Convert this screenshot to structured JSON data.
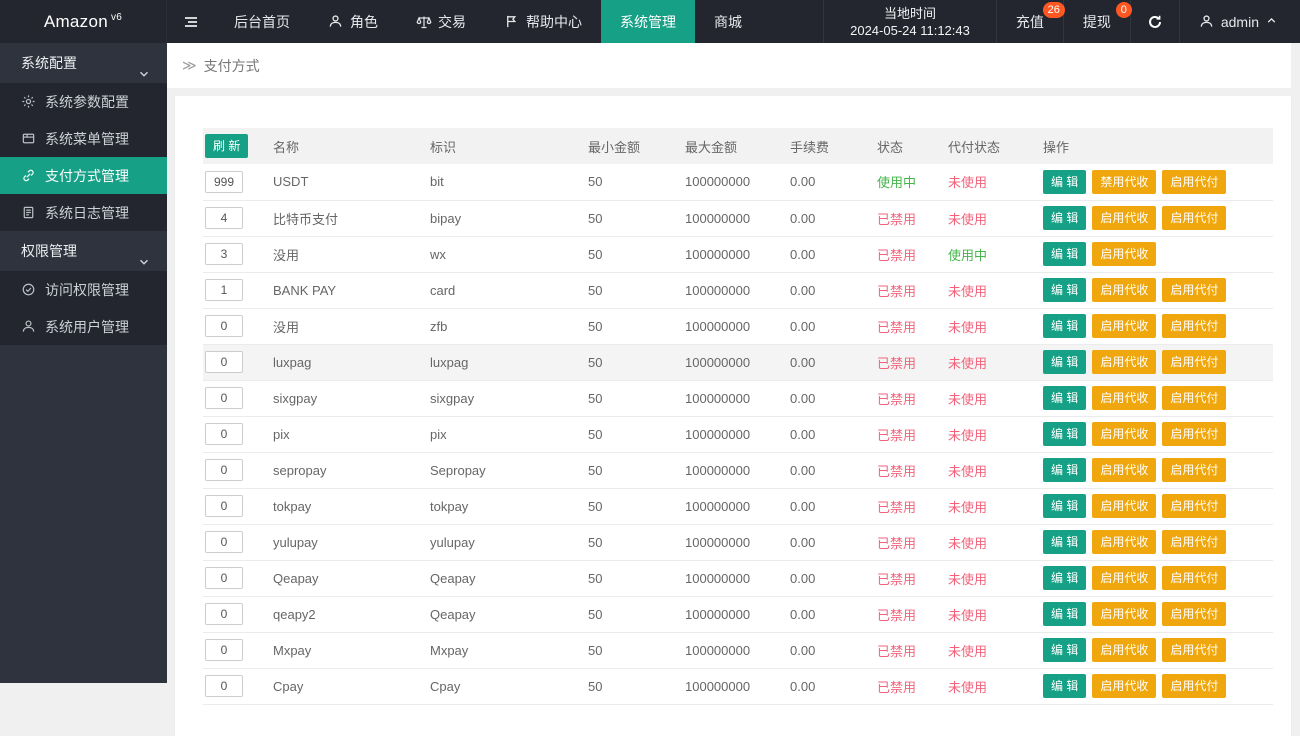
{
  "navbar": {
    "brand": "Amazon",
    "brand_sup": "v6",
    "menu": [
      {
        "label": "后台首页",
        "icon": null
      },
      {
        "label": "角色",
        "icon": "person-icon"
      },
      {
        "label": "交易",
        "icon": "scales-icon"
      },
      {
        "label": "帮助中心",
        "icon": "flag-icon"
      },
      {
        "label": "系统管理",
        "icon": null,
        "active": true
      },
      {
        "label": "商城",
        "icon": null
      }
    ],
    "time_label": "当地时间",
    "time_value": "2024-05-24 11:12:43",
    "recharge": {
      "label": "充值",
      "badge": "26"
    },
    "withdraw": {
      "label": "提现",
      "badge": "0"
    },
    "user": "admin"
  },
  "sidebar": {
    "groups": [
      {
        "label": "系统配置",
        "items": [
          {
            "label": "系统参数配置",
            "icon": "gear-icon"
          },
          {
            "label": "系统菜单管理",
            "icon": "menu-panel-icon"
          },
          {
            "label": "支付方式管理",
            "icon": "link-icon",
            "active": true
          },
          {
            "label": "系统日志管理",
            "icon": "log-file-icon"
          }
        ]
      },
      {
        "label": "权限管理",
        "items": [
          {
            "label": "访问权限管理",
            "icon": "shield-check-icon"
          },
          {
            "label": "系统用户管理",
            "icon": "user-icon"
          }
        ]
      }
    ]
  },
  "breadcrumb": {
    "label": "支付方式"
  },
  "table": {
    "refresh_label": "刷 新",
    "headers": [
      "名称",
      "标识",
      "最小金额",
      "最大金额",
      "手续费",
      "状态",
      "代付状态",
      "操作"
    ],
    "rows": [
      {
        "sort": "999",
        "name": "USDT",
        "code": "bit",
        "min": "50",
        "max": "100000000",
        "fee": "0.00",
        "status": {
          "text": "使用中",
          "on": true
        },
        "payout_status": {
          "text": "未使用",
          "on": false
        },
        "actions": [
          {
            "label": "编 辑",
            "kind": "edit"
          },
          {
            "label": "禁用代收",
            "kind": "collect"
          },
          {
            "label": "启用代付",
            "kind": "payout"
          }
        ]
      },
      {
        "sort": "4",
        "name": "比特币支付",
        "code": "bipay",
        "min": "50",
        "max": "100000000",
        "fee": "0.00",
        "status": {
          "text": "已禁用",
          "on": false
        },
        "payout_status": {
          "text": "未使用",
          "on": false
        },
        "actions": [
          {
            "label": "编 辑",
            "kind": "edit"
          },
          {
            "label": "启用代收",
            "kind": "collect"
          },
          {
            "label": "启用代付",
            "kind": "payout"
          }
        ]
      },
      {
        "sort": "3",
        "name": "没用",
        "code": "wx",
        "min": "50",
        "max": "100000000",
        "fee": "0.00",
        "status": {
          "text": "已禁用",
          "on": false
        },
        "payout_status": {
          "text": "使用中",
          "on": true
        },
        "actions": [
          {
            "label": "编 辑",
            "kind": "edit"
          },
          {
            "label": "启用代收",
            "kind": "collect"
          }
        ]
      },
      {
        "sort": "1",
        "name": "BANK PAY",
        "code": "card",
        "min": "50",
        "max": "100000000",
        "fee": "0.00",
        "status": {
          "text": "已禁用",
          "on": false
        },
        "payout_status": {
          "text": "未使用",
          "on": false
        },
        "actions": [
          {
            "label": "编 辑",
            "kind": "edit"
          },
          {
            "label": "启用代收",
            "kind": "collect"
          },
          {
            "label": "启用代付",
            "kind": "payout"
          }
        ]
      },
      {
        "sort": "0",
        "name": "没用",
        "code": "zfb",
        "min": "50",
        "max": "100000000",
        "fee": "0.00",
        "status": {
          "text": "已禁用",
          "on": false
        },
        "payout_status": {
          "text": "未使用",
          "on": false
        },
        "actions": [
          {
            "label": "编 辑",
            "kind": "edit"
          },
          {
            "label": "启用代收",
            "kind": "collect"
          },
          {
            "label": "启用代付",
            "kind": "payout"
          }
        ]
      },
      {
        "sort": "0",
        "name": "luxpag",
        "code": "luxpag",
        "min": "50",
        "max": "100000000",
        "fee": "0.00",
        "hover": true,
        "status": {
          "text": "已禁用",
          "on": false
        },
        "payout_status": {
          "text": "未使用",
          "on": false
        },
        "actions": [
          {
            "label": "编 辑",
            "kind": "edit"
          },
          {
            "label": "启用代收",
            "kind": "collect"
          },
          {
            "label": "启用代付",
            "kind": "payout"
          }
        ]
      },
      {
        "sort": "0",
        "name": "sixgpay",
        "code": "sixgpay",
        "min": "50",
        "max": "100000000",
        "fee": "0.00",
        "status": {
          "text": "已禁用",
          "on": false
        },
        "payout_status": {
          "text": "未使用",
          "on": false
        },
        "actions": [
          {
            "label": "编 辑",
            "kind": "edit"
          },
          {
            "label": "启用代收",
            "kind": "collect"
          },
          {
            "label": "启用代付",
            "kind": "payout"
          }
        ]
      },
      {
        "sort": "0",
        "name": "pix",
        "code": "pix",
        "min": "50",
        "max": "100000000",
        "fee": "0.00",
        "status": {
          "text": "已禁用",
          "on": false
        },
        "payout_status": {
          "text": "未使用",
          "on": false
        },
        "actions": [
          {
            "label": "编 辑",
            "kind": "edit"
          },
          {
            "label": "启用代收",
            "kind": "collect"
          },
          {
            "label": "启用代付",
            "kind": "payout"
          }
        ]
      },
      {
        "sort": "0",
        "name": "sepropay",
        "code": "Sepropay",
        "min": "50",
        "max": "100000000",
        "fee": "0.00",
        "status": {
          "text": "已禁用",
          "on": false
        },
        "payout_status": {
          "text": "未使用",
          "on": false
        },
        "actions": [
          {
            "label": "编 辑",
            "kind": "edit"
          },
          {
            "label": "启用代收",
            "kind": "collect"
          },
          {
            "label": "启用代付",
            "kind": "payout"
          }
        ]
      },
      {
        "sort": "0",
        "name": "tokpay",
        "code": "tokpay",
        "min": "50",
        "max": "100000000",
        "fee": "0.00",
        "status": {
          "text": "已禁用",
          "on": false
        },
        "payout_status": {
          "text": "未使用",
          "on": false
        },
        "actions": [
          {
            "label": "编 辑",
            "kind": "edit"
          },
          {
            "label": "启用代收",
            "kind": "collect"
          },
          {
            "label": "启用代付",
            "kind": "payout"
          }
        ]
      },
      {
        "sort": "0",
        "name": "yulupay",
        "code": "yulupay",
        "min": "50",
        "max": "100000000",
        "fee": "0.00",
        "status": {
          "text": "已禁用",
          "on": false
        },
        "payout_status": {
          "text": "未使用",
          "on": false
        },
        "actions": [
          {
            "label": "编 辑",
            "kind": "edit"
          },
          {
            "label": "启用代收",
            "kind": "collect"
          },
          {
            "label": "启用代付",
            "kind": "payout"
          }
        ]
      },
      {
        "sort": "0",
        "name": "Qeapay",
        "code": "Qeapay",
        "min": "50",
        "max": "100000000",
        "fee": "0.00",
        "status": {
          "text": "已禁用",
          "on": false
        },
        "payout_status": {
          "text": "未使用",
          "on": false
        },
        "actions": [
          {
            "label": "编 辑",
            "kind": "edit"
          },
          {
            "label": "启用代收",
            "kind": "collect"
          },
          {
            "label": "启用代付",
            "kind": "payout"
          }
        ]
      },
      {
        "sort": "0",
        "name": "qeapy2",
        "code": "Qeapay",
        "min": "50",
        "max": "100000000",
        "fee": "0.00",
        "status": {
          "text": "已禁用",
          "on": false
        },
        "payout_status": {
          "text": "未使用",
          "on": false
        },
        "actions": [
          {
            "label": "编 辑",
            "kind": "edit"
          },
          {
            "label": "启用代收",
            "kind": "collect"
          },
          {
            "label": "启用代付",
            "kind": "payout"
          }
        ]
      },
      {
        "sort": "0",
        "name": "Mxpay",
        "code": "Mxpay",
        "min": "50",
        "max": "100000000",
        "fee": "0.00",
        "status": {
          "text": "已禁用",
          "on": false
        },
        "payout_status": {
          "text": "未使用",
          "on": false
        },
        "actions": [
          {
            "label": "编 辑",
            "kind": "edit"
          },
          {
            "label": "启用代收",
            "kind": "collect"
          },
          {
            "label": "启用代付",
            "kind": "payout"
          }
        ]
      },
      {
        "sort": "0",
        "name": "Cpay",
        "code": "Cpay",
        "min": "50",
        "max": "100000000",
        "fee": "0.00",
        "status": {
          "text": "已禁用",
          "on": false
        },
        "payout_status": {
          "text": "未使用",
          "on": false
        },
        "actions": [
          {
            "label": "编 辑",
            "kind": "edit"
          },
          {
            "label": "启用代收",
            "kind": "collect"
          },
          {
            "label": "启用代付",
            "kind": "payout"
          }
        ]
      }
    ]
  },
  "colors": {
    "accent_teal": "#16A086",
    "warn_yellow": "#F0A70D",
    "badge_red": "#FF5722",
    "status_on_green": "#44B549",
    "status_off_red": "#F2637B",
    "navbar_bg": "#23262E",
    "sidebar_bg": "#2F333E",
    "sidebar_sub_bg": "#23262E"
  }
}
